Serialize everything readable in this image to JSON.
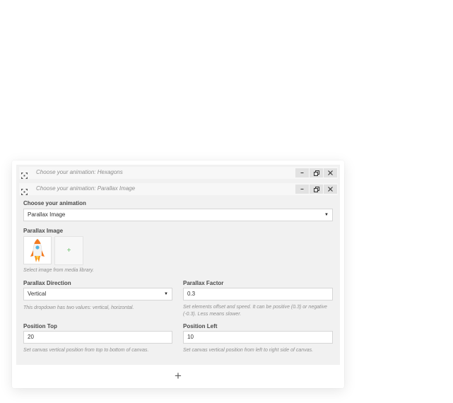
{
  "blocks": [
    {
      "title": "Choose your animation: Hexagons",
      "collapsed": true
    },
    {
      "title": "Choose your animation: Parallax Image",
      "collapsed": false
    }
  ],
  "form": {
    "animation_label": "Choose your animation",
    "animation_value": "Parallax Image",
    "image_label": "Parallax Image",
    "image_add_symbol": "+",
    "image_help": "Select image from media library.",
    "direction_label": "Parallax Direction",
    "direction_value": "Vertical",
    "direction_help": "This dropdown has two values: vertical, horizontal.",
    "factor_label": "Parallax Factor",
    "factor_value": "0.3",
    "factor_help": "Set elements offset and speed. It can be positive (0.3) or negative (-0.3). Less means slower.",
    "top_label": "Position Top",
    "top_value": "20",
    "top_help": "Set canvas vertical position from top to bottom of canvas.",
    "left_label": "Position Left",
    "left_value": "10",
    "left_help": "Set canvas vertical position from left to right side of canvas."
  },
  "add_row_symbol": "+",
  "icons": {
    "drag": "move-icon",
    "minimize": "minimize-icon",
    "duplicate": "duplicate-icon",
    "close": "close-icon",
    "caret": "caret-down-icon",
    "rocket": "rocket-image"
  },
  "colors": {
    "panel": "#ffffff",
    "block_bg": "#f1f1f1",
    "bar_bg": "#f7f7f7",
    "button_bg": "#e2e2e2",
    "add_symbol": "#6cbf6c",
    "rocket_flame": "#f47b20"
  }
}
